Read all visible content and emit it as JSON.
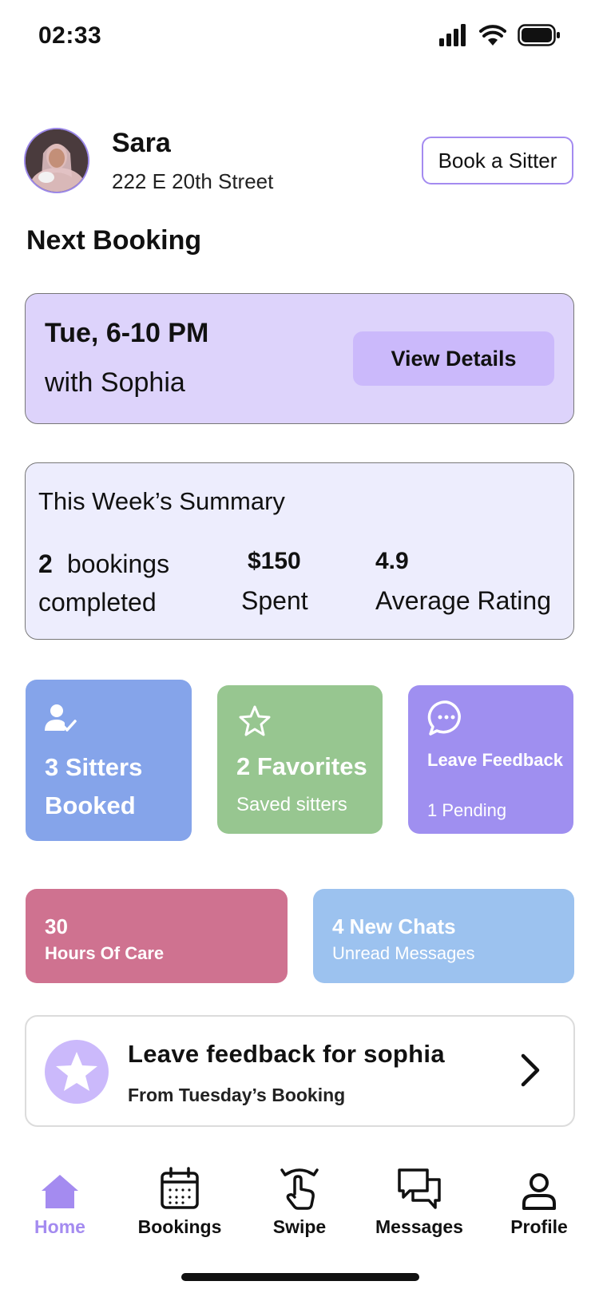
{
  "status_bar": {
    "time": "02:33"
  },
  "header": {
    "user_name": "Sara",
    "address": "222 E 20th Street",
    "book_button": "Book a Sitter"
  },
  "next_booking": {
    "section_title": "Next Booking",
    "time": "Tue, 6-10 PM",
    "with": "with Sophia",
    "details_button": "View Details"
  },
  "summary": {
    "title": "This Week’s Summary",
    "bookings_count": "2",
    "bookings_label": "bookings",
    "bookings_label2": "completed",
    "spent_value": "$150",
    "spent_label": "Spent",
    "rating_value": "4.9",
    "rating_label": "Average Rating"
  },
  "tiles": {
    "sitters": {
      "title": "3 Sitters Booked",
      "icon": "user-check-icon",
      "color": "#85a4ea"
    },
    "favorites": {
      "title": "2 Favorites",
      "subtitle": "Saved sitters",
      "icon": "star-outline-icon",
      "color": "#97c690"
    },
    "feedback": {
      "title": "Leave Feedback",
      "subtitle": "1 Pending",
      "icon": "chat-bubble-icon",
      "color": "#9f8ff0"
    },
    "hours": {
      "title": "30",
      "subtitle": "Hours Of Care",
      "color": "#cf7290"
    },
    "chats": {
      "title": "4 New Chats",
      "subtitle": "Unread Messages",
      "color": "#9cc2ef"
    }
  },
  "feedback_banner": {
    "title": "Leave feedback for sophia",
    "subtitle": "From Tuesday’s Booking",
    "icon": "star-icon"
  },
  "bottom_nav": {
    "active": "Home",
    "items": [
      {
        "label": "Home",
        "icon": "home-icon"
      },
      {
        "label": "Bookings",
        "icon": "calendar-icon"
      },
      {
        "label": "Swipe",
        "icon": "swipe-icon"
      },
      {
        "label": "Messages",
        "icon": "messages-icon"
      },
      {
        "label": "Profile",
        "icon": "profile-icon"
      }
    ]
  },
  "colors": {
    "accent": "#a48bf0",
    "booking_card": "#ddd3fb",
    "summary_card": "#ededfd"
  }
}
